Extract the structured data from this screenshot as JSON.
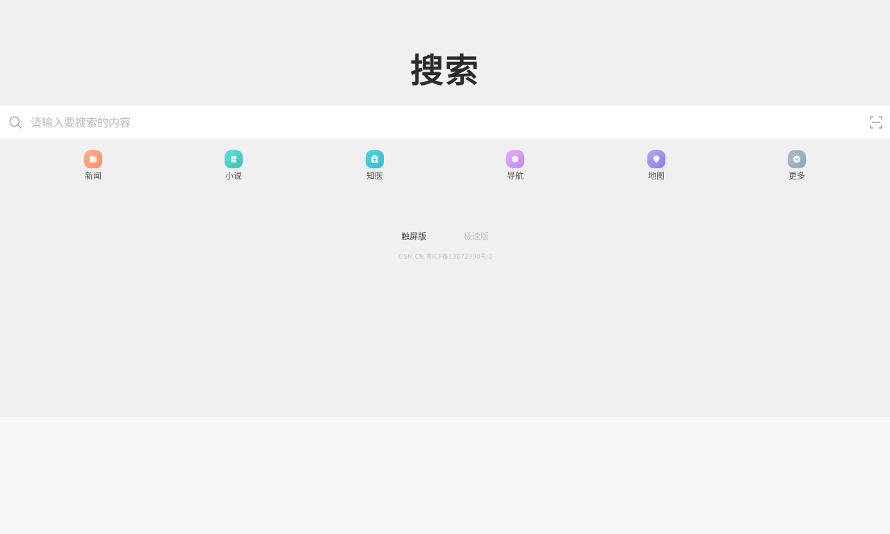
{
  "logo": {
    "text": "搜索"
  },
  "search": {
    "placeholder": "请输入要搜索的内容",
    "value": "",
    "icon": "search-icon",
    "scan_icon": "scan-icon"
  },
  "quick_links": [
    {
      "label": "新闻",
      "icon": "news-icon",
      "color": "#ff9f72"
    },
    {
      "label": "小说",
      "icon": "novel-icon",
      "color": "#4fd0c9"
    },
    {
      "label": "知医",
      "icon": "medical-kit-icon",
      "color": "#45c9d8"
    },
    {
      "label": "导航",
      "icon": "navigation-icon",
      "color": "#d69af5"
    },
    {
      "label": "地图",
      "icon": "map-pin-icon",
      "color": "#a78df6"
    },
    {
      "label": "更多",
      "icon": "more-chevron-icon",
      "color": "#9fb3c3"
    }
  ],
  "versions": {
    "touch": "触屏版",
    "lite": "极速版"
  },
  "footer": {
    "copyright": "©SM.CN 粤ICP备13072090号-2"
  },
  "colors": {
    "top_background": "#f0f0f2",
    "bottom_background": "#f7f7f9",
    "search_background": "#ffffff",
    "placeholder": "#b8b8bc"
  }
}
